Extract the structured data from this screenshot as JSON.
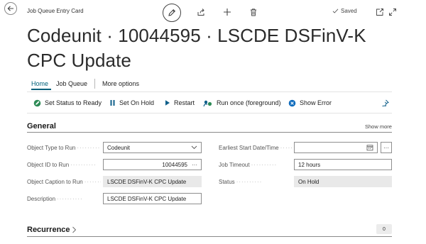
{
  "window": {
    "page_caption": "Job Queue Entry Card",
    "saved_label": "Saved"
  },
  "header": {
    "title": "Codeunit · 10044595 · LSCDE DSFinV-K CPC Update"
  },
  "tabs": [
    {
      "label": "Home",
      "active": true
    },
    {
      "label": "Job Queue",
      "active": false
    },
    {
      "label": "More options",
      "active": false
    }
  ],
  "actions": [
    {
      "label": "Set Status to Ready",
      "icon": "status-ready-icon"
    },
    {
      "label": "Set On Hold",
      "icon": "pause-icon"
    },
    {
      "label": "Restart",
      "icon": "play-icon"
    },
    {
      "label": "Run once (foreground)",
      "icon": "run-once-icon"
    },
    {
      "label": "Show Error",
      "icon": "error-icon"
    }
  ],
  "general": {
    "title": "General",
    "show_more": "Show more",
    "fields": {
      "object_type": {
        "label": "Object Type to Run",
        "value": "Codeunit"
      },
      "object_id": {
        "label": "Object ID to Run",
        "value": "10044595"
      },
      "object_caption": {
        "label": "Object Caption to Run",
        "value": "LSCDE DSFinV-K CPC Update"
      },
      "description": {
        "label": "Description",
        "value": "LSCDE DSFinV-K CPC Update"
      },
      "earliest_start": {
        "label": "Earliest Start Date/Time",
        "value": ""
      },
      "job_timeout": {
        "label": "Job Timeout",
        "value": "12 hours"
      },
      "status": {
        "label": "Status",
        "value": "On Hold"
      }
    },
    "lookup_label": "···"
  },
  "recurrence": {
    "title": "Recurrence",
    "count": "0"
  },
  "colors": {
    "accent": "#00607a",
    "ready_green": "#2e8b57",
    "error_blue": "#0f6cbd"
  }
}
